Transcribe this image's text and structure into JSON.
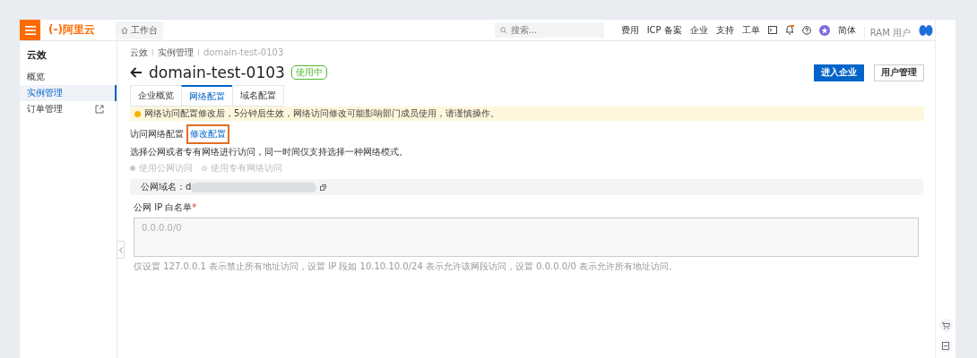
{
  "header": {
    "logo": "(-)阿里云",
    "workbench": "工作台",
    "search_placeholder": "搜索...",
    "nav": [
      "费用",
      "ICP 备案",
      "企业",
      "支持",
      "工单"
    ],
    "language": "简体",
    "account_type": "RAM 用户"
  },
  "sidebar": {
    "title": "云效",
    "items": [
      {
        "label": "概览",
        "selected": false,
        "external": false
      },
      {
        "label": "实例管理",
        "selected": true,
        "external": false
      },
      {
        "label": "订单管理",
        "selected": false,
        "external": true
      }
    ]
  },
  "breadcrumb": [
    "云效",
    "实例管理",
    "domain-test-0103"
  ],
  "title": "domain-test-0103",
  "status": "使用中",
  "actions": [
    {
      "label": "进入企业",
      "kind": "primary"
    },
    {
      "label": "用户管理",
      "kind": "secondary"
    }
  ],
  "tabs": [
    {
      "label": "企业概览",
      "selected": false
    },
    {
      "label": "网络配置",
      "selected": true
    },
    {
      "label": "域名配置",
      "selected": false
    }
  ],
  "notice": "网络访问配置修改后，5分钟后生效，网络访问修改可能影响部门成员使用，请谨慎操作。",
  "section": {
    "title": "访问网络配置",
    "edit_link": "修改配置",
    "description": "选择公网或者专有网络进行访问，同一时间仅支持选择一种网络模式。"
  },
  "radios": [
    {
      "label": "使用公网访问",
      "selected": true,
      "disabled": true
    },
    {
      "label": "使用专有网络访问",
      "selected": false,
      "disabled": true
    }
  ],
  "domain": {
    "label": "公网域名：",
    "value": "d"
  },
  "whitelist": {
    "label": "公网 IP 白名单",
    "required_mark": "*",
    "placeholder": "0.0.0.0/0",
    "help": "仅设置 127.0.0.1 表示禁止所有地址访问，设置 IP 段如 10.10.10.0/24 表示允许该网段访问，设置 0.0.0.0/0 表示允许所有地址访问。"
  }
}
